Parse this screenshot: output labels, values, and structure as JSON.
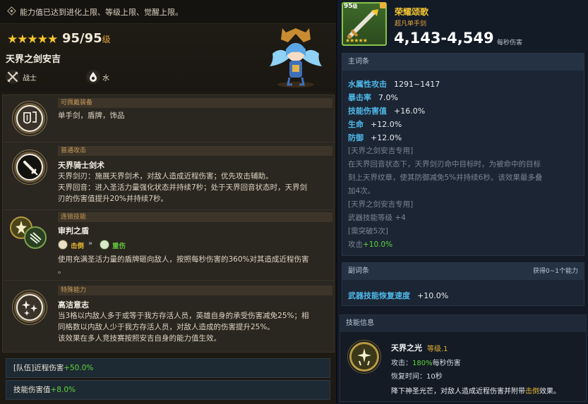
{
  "notice": "能力值已达到进化上限、等级上限、觉醒上限。",
  "hero": {
    "stars": "★★★★★",
    "level": "95/95",
    "level_unit": "级",
    "name": "天界之剑安吉",
    "class_label": "战士",
    "element_label": "水"
  },
  "sections": {
    "equip": {
      "header": "可佩戴装备",
      "text": "单手剑，盾牌，饰品"
    },
    "normal": {
      "header": "普通攻击",
      "title": "天界骑士剑术",
      "lines": [
        "天界剑刃：施展天界剑术，对敌人造成近程伤害；优先攻击辅助。",
        "天界回音：进入圣活力量强化状态并持续7秒；处于天界回音状态时，天界剑",
        "刃的伤害值提升20%并持续7秒。"
      ]
    },
    "chain": {
      "header": "连锁技能",
      "title": "审判之盾",
      "tag1": "击倒",
      "arrow": "»",
      "tag2": "重伤",
      "lines": [
        "使用充满圣活力量的盾牌砸向敌人，按照每秒伤害的360%对其造成近程伤害",
        "。"
      ]
    },
    "special": {
      "header": "特殊能力",
      "title": "高洁意志",
      "lines": [
        "当3格以内敌人多于或等于我方存活人员，英雄自身的承受伤害减免25%；相",
        "同格数以内敌人少于我方存活人员，对敌人造成的伤害提升25%。",
        "该效果在多人竞技赛按照安吉自身的能力值生效。"
      ]
    }
  },
  "bonuses": [
    {
      "label": "[队伍]近程伤害",
      "value": "+50.0%"
    },
    {
      "label": "技能伤害值",
      "value": "+8.0%"
    }
  ],
  "weapon": {
    "level": "95",
    "level_unit": "级",
    "stars": "★★★★★",
    "name": "荣耀颂歌",
    "type": "超凡单手剑",
    "damage": "4,143-4,549",
    "damage_label": "每秒伤害"
  },
  "main_options": {
    "header": "主词条",
    "stats": [
      {
        "key": "水属性攻击",
        "value": "1291~1417"
      },
      {
        "key": "暴击率",
        "value": "7.0%"
      },
      {
        "key": "技能伤害值",
        "value": "+16.0%"
      },
      {
        "key": "生命",
        "value": "+12.0%"
      },
      {
        "key": "防御",
        "value": "+12.0%"
      }
    ],
    "exclusive1_label": "[天界之剑安吉专用]",
    "exclusive1_lines": [
      "在天界回音状态下，天界剑刃命中目标时，为被命中的目标",
      "刻上天界纹章，使其防御减免5%并持续6秒。该效果最多叠",
      "加4次。"
    ],
    "exclusive2_label": "[天界之剑安吉专用]",
    "skill_level_line": "武器技能等级 +4",
    "limit_break_line": "[需突破5次]",
    "attack_label": "攻击",
    "attack_value": "+10.0%"
  },
  "sub_options": {
    "header": "副词条",
    "gain_label": "获得0~1个能力",
    "stat_key": "武器技能恢复速度",
    "stat_value": "+10.0%"
  },
  "skill_info": {
    "header": "技能信息",
    "name": "天界之光",
    "level": "等级.1",
    "attack_label": "攻击：",
    "attack_value": "180%",
    "attack_suffix": "每秒伤害",
    "recovery_label": "恢复时间：",
    "recovery_value": "10秒",
    "desc_prefix": "降下神圣光芒，对敌人造成近程伤害并附带",
    "desc_keyword": "击倒",
    "desc_suffix": "效果。"
  },
  "colors": {
    "gold": "#f4c531",
    "green": "#5fd43a",
    "blue_key": "#4fb8e8",
    "orange": "#e0a23a"
  }
}
